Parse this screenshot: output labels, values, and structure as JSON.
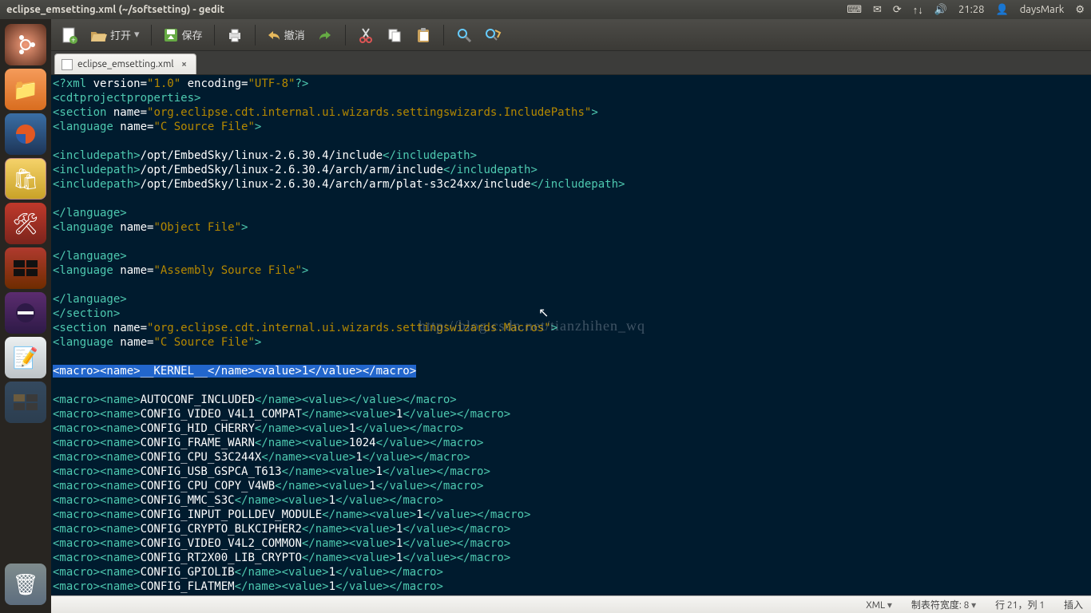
{
  "panel": {
    "title": "eclipse_emsetting.xml (~/softsetting) - gedit",
    "time": "21:28",
    "user": "daysMark"
  },
  "toolbar": {
    "open": "打开",
    "save": "保存",
    "undo": "撤消"
  },
  "tab": {
    "name": "eclipse_emsetting.xml"
  },
  "code_lines": [
    [
      [
        "t-tag",
        "<?xml"
      ],
      [
        "",
        ""
      ],
      [
        "t-txt",
        " version="
      ],
      [
        "t-str",
        "\"1.0\""
      ],
      [
        "t-txt",
        " encoding="
      ],
      [
        "t-str",
        "\"UTF-8\""
      ],
      [
        "t-tag",
        "?>"
      ]
    ],
    [
      [
        "t-tag",
        "<cdtprojectproperties>"
      ]
    ],
    [
      [
        "t-tag",
        "<section"
      ],
      [
        "t-txt",
        " name="
      ],
      [
        "t-str",
        "\"org.eclipse.cdt.internal.ui.wizards.settingswizards.IncludePaths\""
      ],
      [
        "t-tag",
        ">"
      ]
    ],
    [
      [
        "t-tag",
        "<language"
      ],
      [
        "t-txt",
        " name="
      ],
      [
        "t-str",
        "\"C Source File\""
      ],
      [
        "t-tag",
        ">"
      ]
    ],
    [
      [
        "",
        ""
      ]
    ],
    [
      [
        "t-tag",
        "<includepath>"
      ],
      [
        "t-txt",
        "/opt/EmbedSky/linux-2.6.30.4/include"
      ],
      [
        "t-tag",
        "</includepath>"
      ]
    ],
    [
      [
        "t-tag",
        "<includepath>"
      ],
      [
        "t-txt",
        "/opt/EmbedSky/linux-2.6.30.4/arch/arm/include"
      ],
      [
        "t-tag",
        "</includepath>"
      ]
    ],
    [
      [
        "t-tag",
        "<includepath>"
      ],
      [
        "t-txt",
        "/opt/EmbedSky/linux-2.6.30.4/arch/arm/plat-s3c24xx/include"
      ],
      [
        "t-tag",
        "</includepath>"
      ]
    ],
    [
      [
        "",
        ""
      ]
    ],
    [
      [
        "t-tag",
        "</language>"
      ]
    ],
    [
      [
        "t-tag",
        "<language"
      ],
      [
        "t-txt",
        " name="
      ],
      [
        "t-str",
        "\"Object File\""
      ],
      [
        "t-tag",
        ">"
      ]
    ],
    [
      [
        "",
        ""
      ]
    ],
    [
      [
        "t-tag",
        "</language>"
      ]
    ],
    [
      [
        "t-tag",
        "<language"
      ],
      [
        "t-txt",
        " name="
      ],
      [
        "t-str",
        "\"Assembly Source File\""
      ],
      [
        "t-tag",
        ">"
      ]
    ],
    [
      [
        "",
        ""
      ]
    ],
    [
      [
        "t-tag",
        "</language>"
      ]
    ],
    [
      [
        "t-tag",
        "</section>"
      ]
    ],
    [
      [
        "t-tag",
        "<section"
      ],
      [
        "t-txt",
        " name="
      ],
      [
        "t-str",
        "\"org.eclipse.cdt.internal.ui.wizards.settingswizards.Macros\""
      ],
      [
        "t-tag",
        ">"
      ]
    ],
    [
      [
        "t-tag",
        "<language"
      ],
      [
        "t-txt",
        " name="
      ],
      [
        "t-str",
        "\"C Source File\""
      ],
      [
        "t-tag",
        ">"
      ]
    ],
    [
      [
        "",
        ""
      ]
    ],
    [
      [
        "t-sel",
        "<macro><name>__KERNEL__</name><value>1</value></macro>"
      ]
    ],
    [
      [
        "",
        ""
      ]
    ],
    [
      [
        "t-tag",
        "<macro><name>"
      ],
      [
        "t-txt",
        "AUTOCONF_INCLUDED"
      ],
      [
        "t-tag",
        "</name><value></value></macro>"
      ]
    ],
    [
      [
        "t-tag",
        "<macro><name>"
      ],
      [
        "t-txt",
        "CONFIG_VIDEO_V4L1_COMPAT"
      ],
      [
        "t-tag",
        "</name><value>"
      ],
      [
        "t-txt",
        "1"
      ],
      [
        "t-tag",
        "</value></macro>"
      ]
    ],
    [
      [
        "t-tag",
        "<macro><name>"
      ],
      [
        "t-txt",
        "CONFIG_HID_CHERRY"
      ],
      [
        "t-tag",
        "</name><value>"
      ],
      [
        "t-txt",
        "1"
      ],
      [
        "t-tag",
        "</value></macro>"
      ]
    ],
    [
      [
        "t-tag",
        "<macro><name>"
      ],
      [
        "t-txt",
        "CONFIG_FRAME_WARN"
      ],
      [
        "t-tag",
        "</name><value>"
      ],
      [
        "t-txt",
        "1024"
      ],
      [
        "t-tag",
        "</value></macro>"
      ]
    ],
    [
      [
        "t-tag",
        "<macro><name>"
      ],
      [
        "t-txt",
        "CONFIG_CPU_S3C244X"
      ],
      [
        "t-tag",
        "</name><value>"
      ],
      [
        "t-txt",
        "1"
      ],
      [
        "t-tag",
        "</value></macro>"
      ]
    ],
    [
      [
        "t-tag",
        "<macro><name>"
      ],
      [
        "t-txt",
        "CONFIG_USB_GSPCA_T613"
      ],
      [
        "t-tag",
        "</name><value>"
      ],
      [
        "t-txt",
        "1"
      ],
      [
        "t-tag",
        "</value></macro>"
      ]
    ],
    [
      [
        "t-tag",
        "<macro><name>"
      ],
      [
        "t-txt",
        "CONFIG_CPU_COPY_V4WB"
      ],
      [
        "t-tag",
        "</name><value>"
      ],
      [
        "t-txt",
        "1"
      ],
      [
        "t-tag",
        "</value></macro>"
      ]
    ],
    [
      [
        "t-tag",
        "<macro><name>"
      ],
      [
        "t-txt",
        "CONFIG_MMC_S3C"
      ],
      [
        "t-tag",
        "</name><value>"
      ],
      [
        "t-txt",
        "1"
      ],
      [
        "t-tag",
        "</value></macro>"
      ]
    ],
    [
      [
        "t-tag",
        "<macro><name>"
      ],
      [
        "t-txt",
        "CONFIG_INPUT_POLLDEV_MODULE"
      ],
      [
        "t-tag",
        "</name><value>"
      ],
      [
        "t-txt",
        "1"
      ],
      [
        "t-tag",
        "</value></macro>"
      ]
    ],
    [
      [
        "t-tag",
        "<macro><name>"
      ],
      [
        "t-txt",
        "CONFIG_CRYPTO_BLKCIPHER2"
      ],
      [
        "t-tag",
        "</name><value>"
      ],
      [
        "t-txt",
        "1"
      ],
      [
        "t-tag",
        "</value></macro>"
      ]
    ],
    [
      [
        "t-tag",
        "<macro><name>"
      ],
      [
        "t-txt",
        "CONFIG_VIDEO_V4L2_COMMON"
      ],
      [
        "t-tag",
        "</name><value>"
      ],
      [
        "t-txt",
        "1"
      ],
      [
        "t-tag",
        "</value></macro>"
      ]
    ],
    [
      [
        "t-tag",
        "<macro><name>"
      ],
      [
        "t-txt",
        "CONFIG_RT2X00_LIB_CRYPTO"
      ],
      [
        "t-tag",
        "</name><value>"
      ],
      [
        "t-txt",
        "1"
      ],
      [
        "t-tag",
        "</value></macro>"
      ]
    ],
    [
      [
        "t-tag",
        "<macro><name>"
      ],
      [
        "t-txt",
        "CONFIG_GPIOLIB"
      ],
      [
        "t-tag",
        "</name><value>"
      ],
      [
        "t-txt",
        "1"
      ],
      [
        "t-tag",
        "</value></macro>"
      ]
    ],
    [
      [
        "t-tag",
        "<macro><name>"
      ],
      [
        "t-txt",
        "CONFIG_FLATMEM"
      ],
      [
        "t-tag",
        "</name><value>"
      ],
      [
        "t-txt",
        "1"
      ],
      [
        "t-tag",
        "</value></macro>"
      ]
    ]
  ],
  "watermark": "http://blog.csdn.net/tianzhihen_wq",
  "status": {
    "lang": "XML",
    "tabwidth": "制表符宽度: 8",
    "pos": "行 21，列 1",
    "mode": "插入"
  }
}
